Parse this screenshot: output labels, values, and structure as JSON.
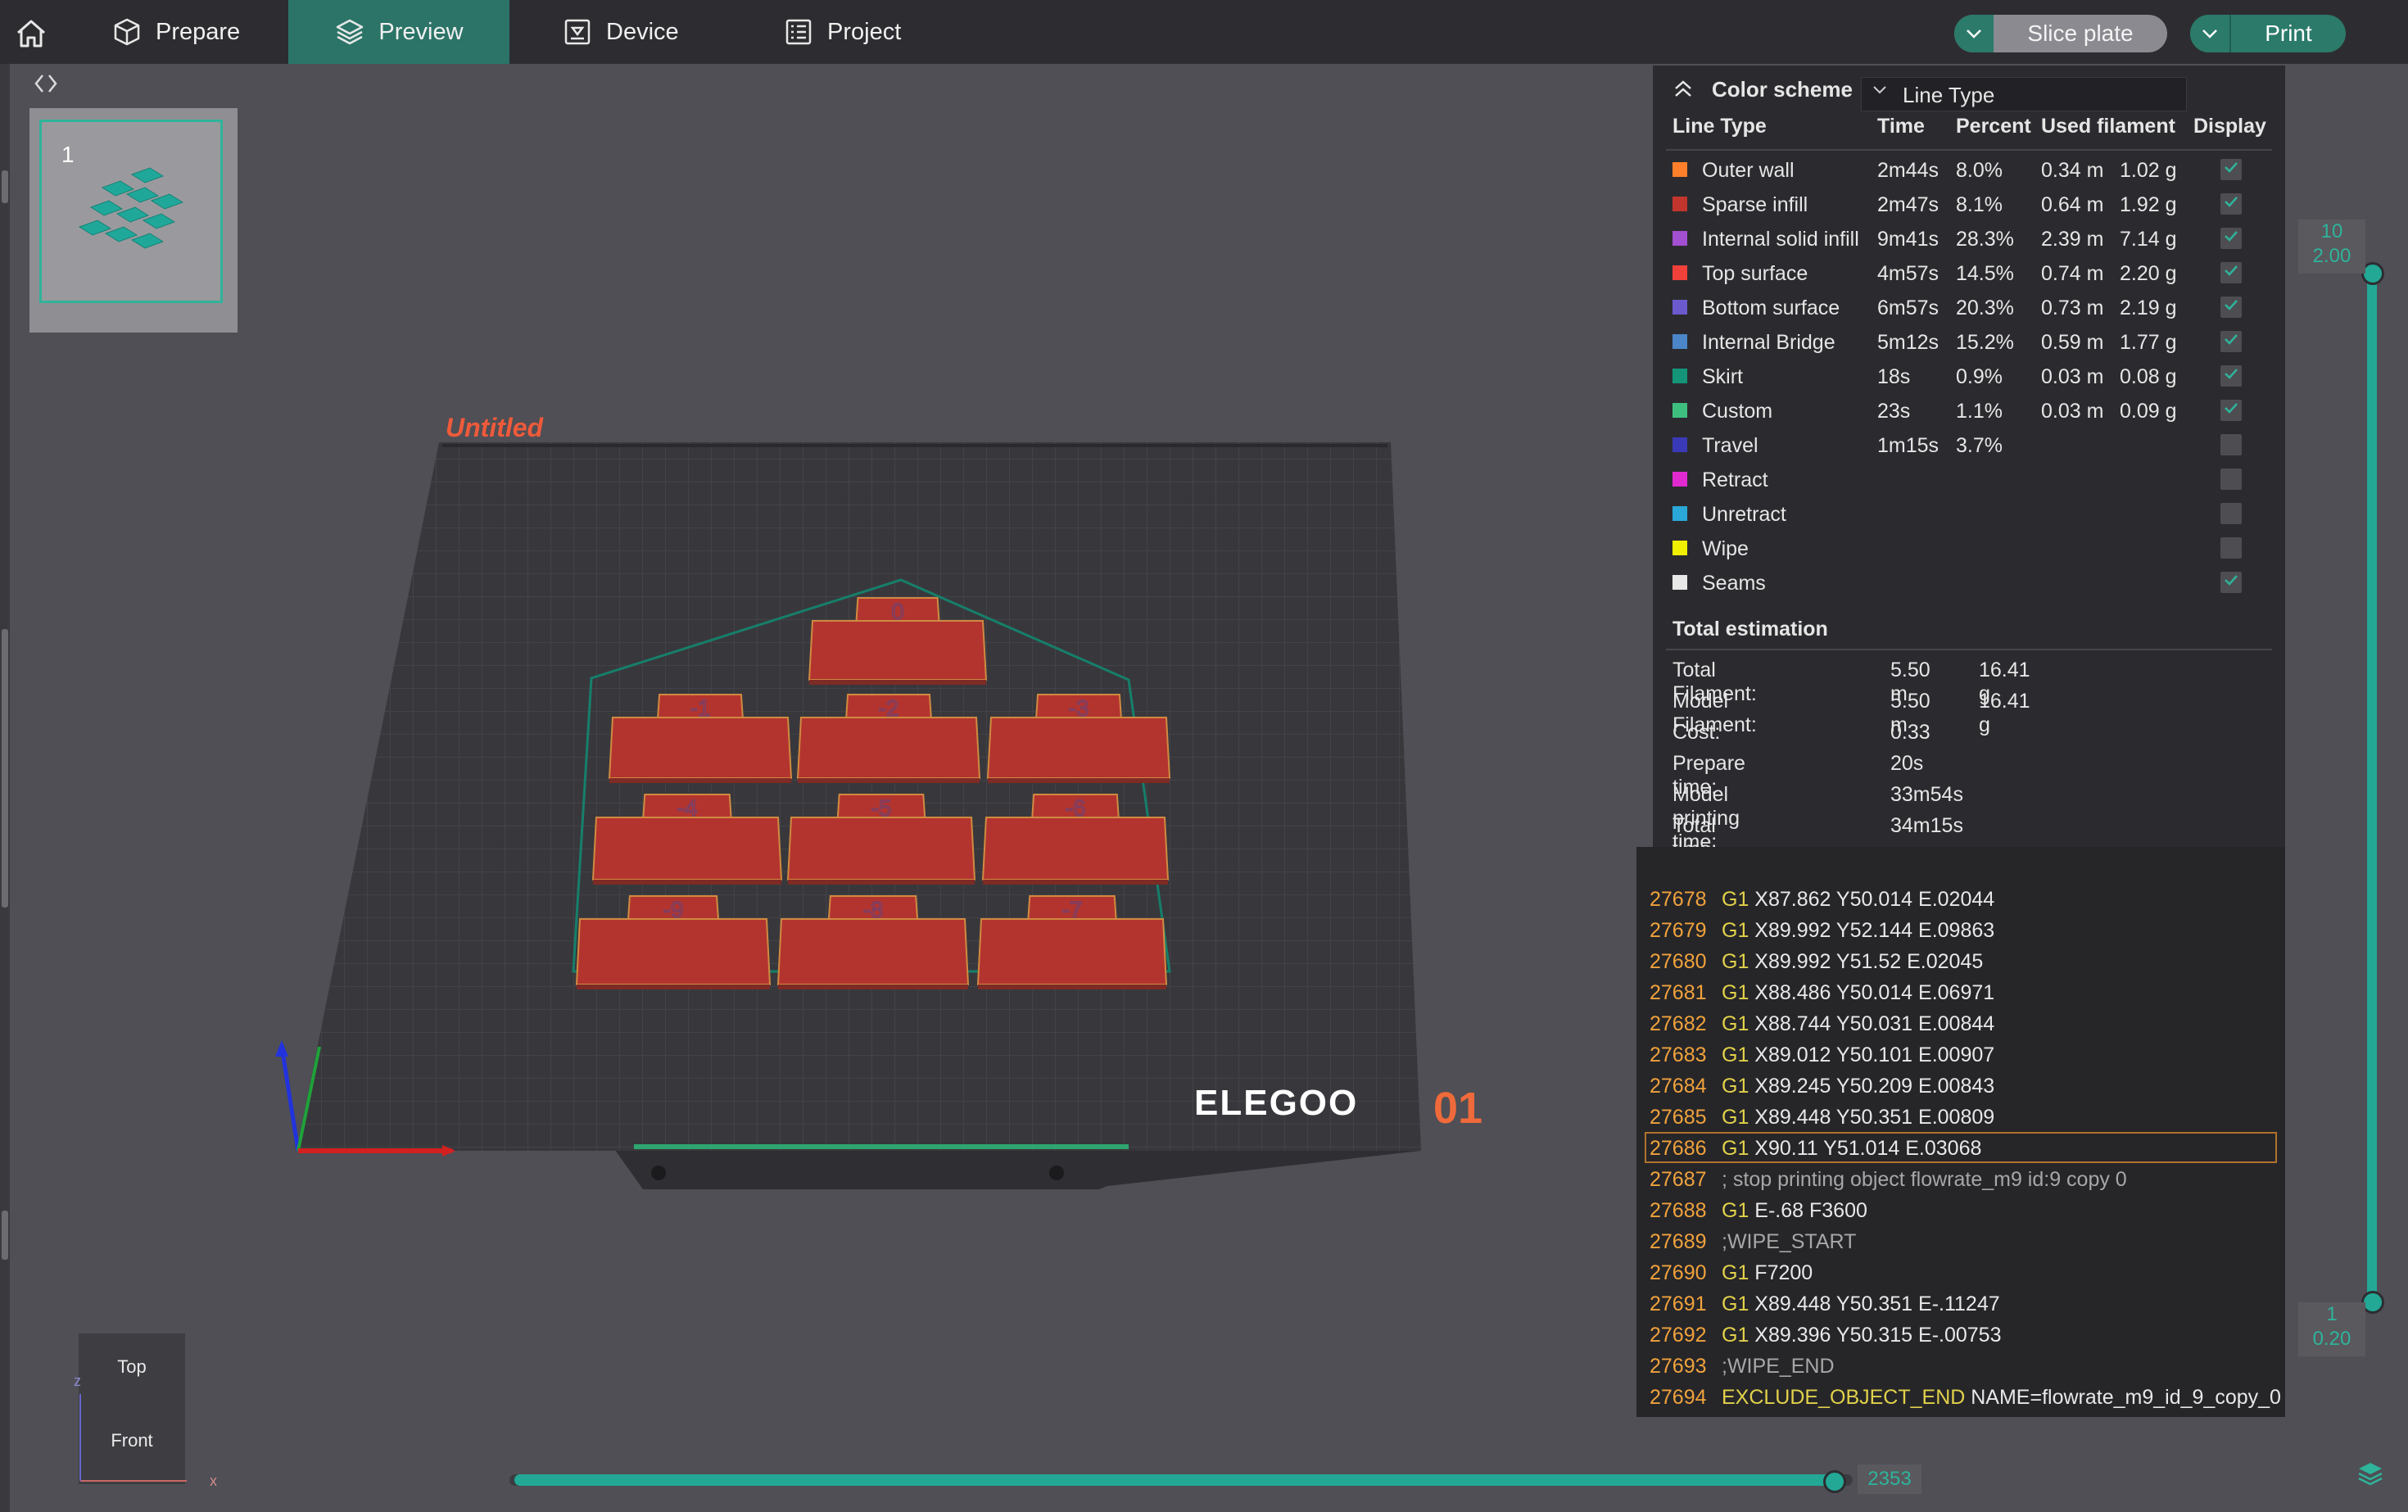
{
  "topbar": {
    "tabs": [
      {
        "label": "Prepare",
        "icon": "cube-icon"
      },
      {
        "label": "Preview",
        "icon": "layers-icon"
      },
      {
        "label": "Device",
        "icon": "device-icon"
      },
      {
        "label": "Project",
        "icon": "project-icon"
      }
    ],
    "active_tab": "Preview",
    "slice_label": "Slice plate",
    "print_label": "Print",
    "accent": "#2b7467"
  },
  "plates": {
    "selected_number": "1"
  },
  "scene": {
    "plate_title": "Untitled",
    "brand": "ELEGOO",
    "plate_code": "01",
    "object_labels": [
      "0",
      "-1",
      "-2",
      "-3",
      "-4",
      "-5",
      "-6",
      "-9",
      "-8",
      "-7"
    ],
    "object_color": "#b3342f"
  },
  "legend": {
    "title": "Color scheme",
    "scheme": "Line Type",
    "headers": {
      "type": "Line Type",
      "time": "Time",
      "percent": "Percent",
      "used": "Used filament",
      "display": "Display"
    },
    "rows": [
      {
        "name": "Outer wall",
        "color": "#ff7f2a",
        "time": "2m44s",
        "pct": "8.0%",
        "len": "0.34 m",
        "g": "1.02 g",
        "checked": true
      },
      {
        "name": "Sparse infill",
        "color": "#c2352d",
        "time": "2m47s",
        "pct": "8.1%",
        "len": "0.64 m",
        "g": "1.92 g",
        "checked": true
      },
      {
        "name": "Internal solid infill",
        "color": "#a24fd1",
        "time": "9m41s",
        "pct": "28.3%",
        "len": "2.39 m",
        "g": "7.14 g",
        "checked": true
      },
      {
        "name": "Top surface",
        "color": "#f0403a",
        "time": "4m57s",
        "pct": "14.5%",
        "len": "0.74 m",
        "g": "2.20 g",
        "checked": true
      },
      {
        "name": "Bottom surface",
        "color": "#6a5acd",
        "time": "6m57s",
        "pct": "20.3%",
        "len": "0.73 m",
        "g": "2.19 g",
        "checked": true
      },
      {
        "name": "Internal Bridge",
        "color": "#4a86c8",
        "time": "5m12s",
        "pct": "15.2%",
        "len": "0.59 m",
        "g": "1.77 g",
        "checked": true
      },
      {
        "name": "Skirt",
        "color": "#14957a",
        "time": "18s",
        "pct": "0.9%",
        "len": "0.03 m",
        "g": "0.08 g",
        "checked": true
      },
      {
        "name": "Custom",
        "color": "#3fbf7f",
        "time": "23s",
        "pct": "1.1%",
        "len": "0.03 m",
        "g": "0.09 g",
        "checked": true
      },
      {
        "name": "Travel",
        "color": "#3a3ab8",
        "time": "1m15s",
        "pct": "3.7%",
        "len": "",
        "g": "",
        "checked": false
      },
      {
        "name": "Retract",
        "color": "#e02ad0",
        "time": "",
        "pct": "",
        "len": "",
        "g": "",
        "checked": false
      },
      {
        "name": "Unretract",
        "color": "#2aa8d8",
        "time": "",
        "pct": "",
        "len": "",
        "g": "",
        "checked": false
      },
      {
        "name": "Wipe",
        "color": "#f0f000",
        "time": "",
        "pct": "",
        "len": "",
        "g": "",
        "checked": false
      },
      {
        "name": "Seams",
        "color": "#e8e8e8",
        "time": "",
        "pct": "",
        "len": "",
        "g": "",
        "checked": true
      }
    ],
    "total_title": "Total estimation",
    "totals": [
      {
        "k": "Total Filament:",
        "v1": "5.50 m",
        "v2": "16.41 g"
      },
      {
        "k": "Model Filament:",
        "v1": "5.50 m",
        "v2": "16.41 g"
      },
      {
        "k": "Cost:",
        "v1": "0.33",
        "v2": ""
      },
      {
        "k": "Prepare time:",
        "v1": "20s",
        "v2": ""
      },
      {
        "k": "Model printing time:",
        "v1": "33m54s",
        "v2": ""
      },
      {
        "k": "Total time:",
        "v1": "34m15s",
        "v2": ""
      }
    ]
  },
  "gcode": {
    "selected_line": "27686",
    "lines": [
      {
        "n": "27678",
        "op": "G1",
        "arg": "X87.862 Y50.014 E.02044",
        "cmt": ""
      },
      {
        "n": "27679",
        "op": "G1",
        "arg": "X89.992 Y52.144 E.09863",
        "cmt": ""
      },
      {
        "n": "27680",
        "op": "G1",
        "arg": "X89.992 Y51.52 E.02045",
        "cmt": ""
      },
      {
        "n": "27681",
        "op": "G1",
        "arg": "X88.486 Y50.014 E.06971",
        "cmt": ""
      },
      {
        "n": "27682",
        "op": "G1",
        "arg": "X88.744 Y50.031 E.00844",
        "cmt": ""
      },
      {
        "n": "27683",
        "op": "G1",
        "arg": "X89.012 Y50.101 E.00907",
        "cmt": ""
      },
      {
        "n": "27684",
        "op": "G1",
        "arg": "X89.245 Y50.209 E.00843",
        "cmt": ""
      },
      {
        "n": "27685",
        "op": "G1",
        "arg": "X89.448 Y50.351 E.00809",
        "cmt": ""
      },
      {
        "n": "27686",
        "op": "G1",
        "arg": "X90.11 Y51.014 E.03068",
        "cmt": ""
      },
      {
        "n": "27687",
        "op": "",
        "arg": "",
        "cmt": "; stop printing object flowrate_m9 id:9 copy 0"
      },
      {
        "n": "27688",
        "op": "G1",
        "arg": "E-.68 F3600",
        "cmt": ""
      },
      {
        "n": "27689",
        "op": "",
        "arg": "",
        "cmt": ";WIPE_START"
      },
      {
        "n": "27690",
        "op": "G1",
        "arg": "F7200",
        "cmt": ""
      },
      {
        "n": "27691",
        "op": "G1",
        "arg": "X89.448 Y50.351 E-.11247",
        "cmt": ""
      },
      {
        "n": "27692",
        "op": "G1",
        "arg": "X89.396 Y50.315 E-.00753",
        "cmt": ""
      },
      {
        "n": "27693",
        "op": "",
        "arg": "",
        "cmt": ";WIPE_END"
      },
      {
        "n": "27694",
        "op": "EXCLUDE_OBJECT_END",
        "arg": "NAME=flowrate_m9_id_9_copy_0",
        "cmt": ""
      }
    ]
  },
  "layer_slider": {
    "top_layer": "10",
    "top_height": "2.00",
    "bottom_layer": "1",
    "bottom_height": "0.20"
  },
  "move_slider": {
    "value": "2353",
    "progress": 0.99
  },
  "view_cube": {
    "top": "Top",
    "front": "Front",
    "axis_z": "z",
    "axis_x": "x"
  }
}
